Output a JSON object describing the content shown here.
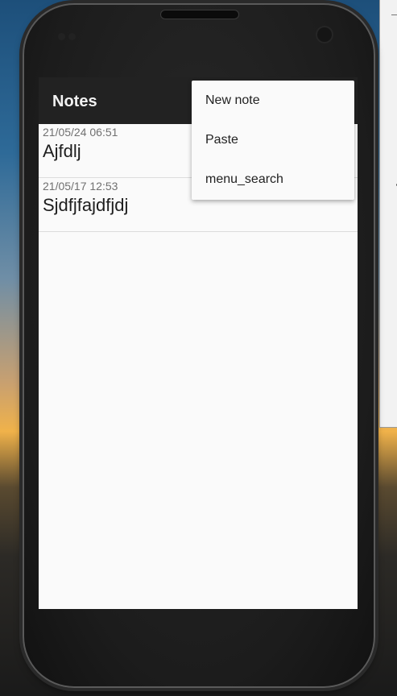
{
  "app": {
    "title": "Notes"
  },
  "notes": [
    {
      "date": "21/05/24 06:51",
      "title": "Ajfdlj"
    },
    {
      "date": "21/05/17 12:53",
      "title": "Sjdfjfajdfjdj"
    }
  ],
  "menu": {
    "items": [
      "New note",
      "Paste",
      "menu_search"
    ]
  },
  "colors": {
    "actionbar": "#222222",
    "screen_bg": "#fafafa",
    "menu_bg": "#fafafa"
  }
}
